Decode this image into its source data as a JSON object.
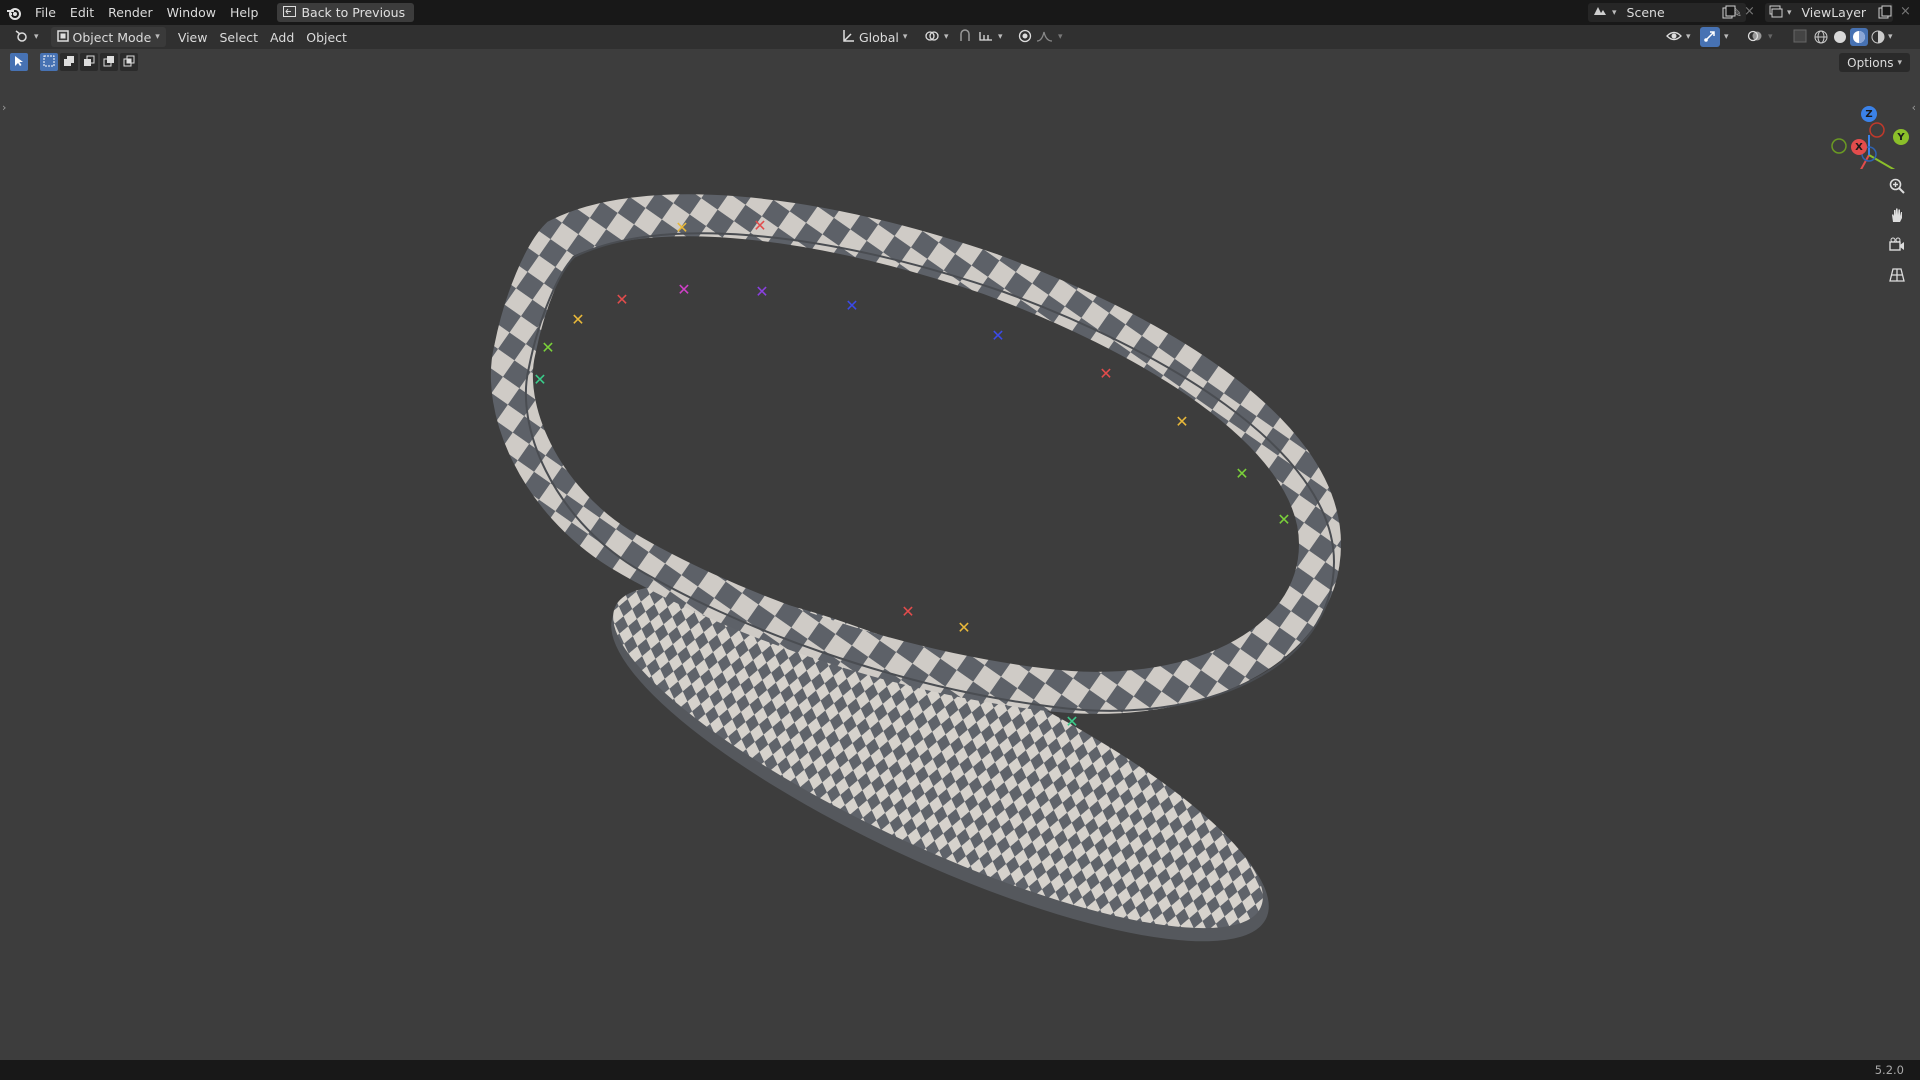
{
  "menus": [
    {
      "label": "File"
    },
    {
      "label": "Edit"
    },
    {
      "label": "Render"
    },
    {
      "label": "Window"
    },
    {
      "label": "Help"
    }
  ],
  "back_button": "Back to Previous",
  "scene": "Scene",
  "view_layer": "ViewLayer",
  "header": {
    "mode": "Object Mode",
    "view": "View",
    "select": "Select",
    "add": "Add",
    "object": "Object",
    "orientation": "Global",
    "options": "Options"
  },
  "gizmo": {
    "x": "X",
    "y": "Y",
    "z": "Z"
  },
  "version": "5.2.0",
  "colors": {
    "accent": "#4772b3",
    "axis_x": "#e24c4c",
    "axis_y": "#8bbf2a",
    "axis_z": "#3b82e8",
    "viewport": "#3d3d3d",
    "topbar": "#181818"
  },
  "icons": [
    "blender-logo-icon",
    "back-icon",
    "scene-icon",
    "pin-icon",
    "copy-icon",
    "close-icon",
    "viewlayer-icon",
    "editor-type-icon",
    "object-mode-icon",
    "transform-orientation-icon",
    "pivot-icon",
    "snap-icon",
    "proportional-icon",
    "visibility-icon",
    "gizmo-icon",
    "overlay-icon",
    "xray-icon",
    "wireframe-shading-icon",
    "solid-shading-icon",
    "material-shading-icon",
    "rendered-shading-icon",
    "zoom-icon",
    "hand-icon",
    "camera-icon",
    "grid-icon"
  ]
}
